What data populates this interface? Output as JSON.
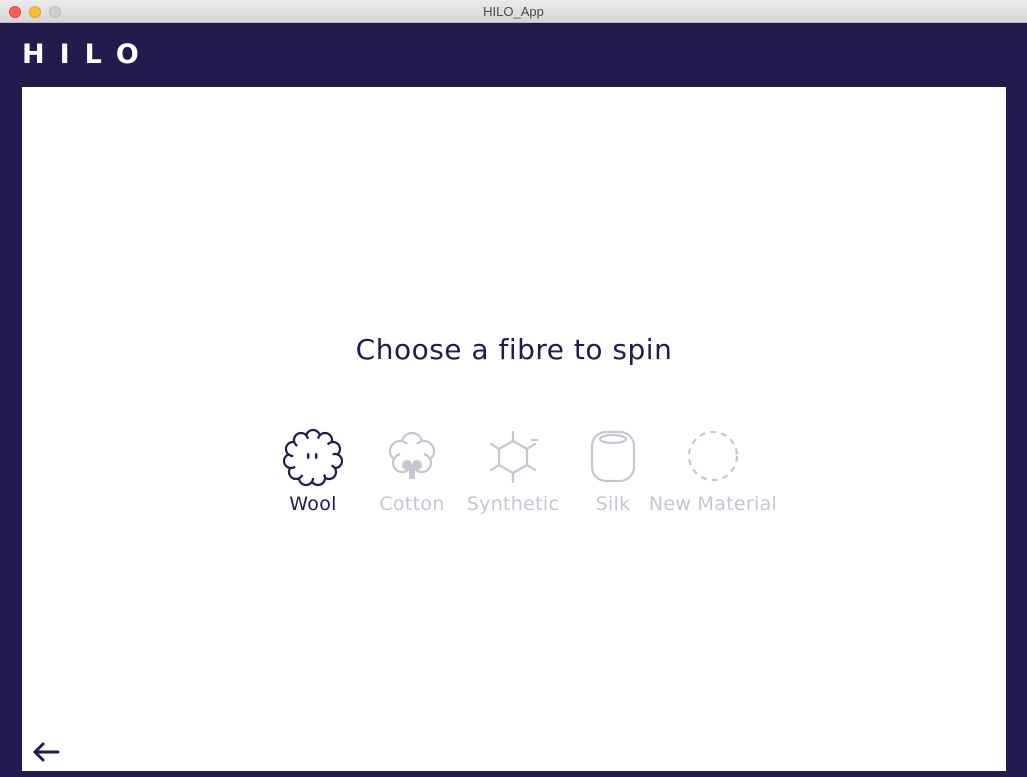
{
  "window": {
    "title": "HILO_App"
  },
  "header": {
    "logo_text": "HILO",
    "background_color": "#241a4d"
  },
  "main": {
    "prompt": "Choose a fibre to spin",
    "fibres": [
      {
        "label": "Wool",
        "icon": "wool-icon",
        "selected": true
      },
      {
        "label": "Cotton",
        "icon": "cotton-icon",
        "selected": false
      },
      {
        "label": "Synthetic",
        "icon": "synthetic-icon",
        "selected": false
      },
      {
        "label": "Silk",
        "icon": "silk-icon",
        "selected": false
      },
      {
        "label": "New Material",
        "icon": "new-material-icon",
        "selected": false
      }
    ],
    "selected_color": "#241a4d",
    "unselected_color": "#c7c5d1"
  },
  "footer": {
    "back_icon": "back-arrow-icon"
  }
}
